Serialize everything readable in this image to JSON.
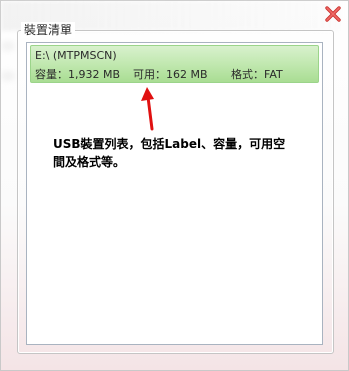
{
  "groupbox": {
    "title": "裝置清單"
  },
  "devices": [
    {
      "name": "E:\\ (MTPMSCN)",
      "capacity": "容量：1,932 MB",
      "free": "可用：162 MB",
      "format": "格式：FAT"
    }
  ],
  "annotation": {
    "line1": "USB裝置列表，包括Label、容量，可用空",
    "line2": "間及格式等。"
  },
  "icons": {
    "close": "close-x-icon",
    "arrow": "red-arrow-icon"
  },
  "colors": {
    "selected_item": "#bfe7ad",
    "close": "#d9534f",
    "arrow": "#e01010"
  }
}
